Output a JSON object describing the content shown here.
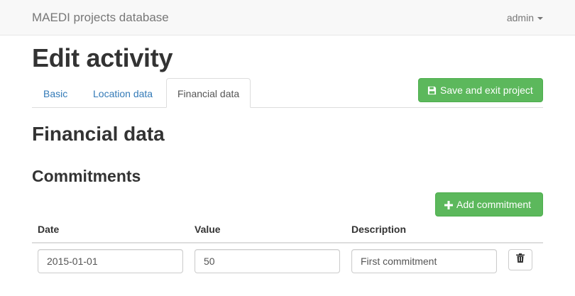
{
  "navbar": {
    "brand": "MAEDI projects database",
    "user_label": "admin",
    "user_icon": "chevron-down-icon"
  },
  "page": {
    "title": "Edit activity"
  },
  "tabs": [
    {
      "label": "Basic",
      "active": false
    },
    {
      "label": "Location data",
      "active": false
    },
    {
      "label": "Financial data",
      "active": true
    }
  ],
  "actions": {
    "save_label": "Save and exit project",
    "save_icon": "floppy-disk-icon",
    "add_commitment_label": "Add commitment",
    "add_commitment_icon": "plus-icon"
  },
  "section": {
    "title": "Financial data",
    "subtitle": "Commitments"
  },
  "commitments": {
    "columns": [
      "Date",
      "Value",
      "Description"
    ],
    "rows": [
      {
        "date": "2015-01-01",
        "value": "50",
        "description": "First commitment",
        "delete_icon": "trash-icon"
      }
    ]
  },
  "colors": {
    "success": "#5cb85c",
    "link": "#337ab7",
    "navbar_bg": "#f8f8f8"
  }
}
